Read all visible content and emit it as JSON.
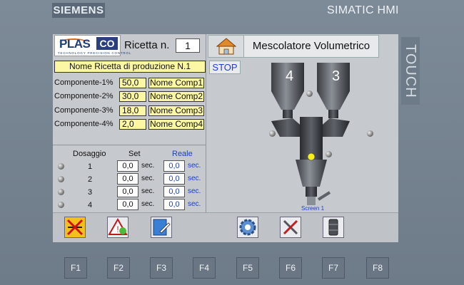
{
  "device": {
    "brand": "SIEMENS",
    "model": "SIMATIC HMI",
    "touch_label": "TOUCH"
  },
  "logo": {
    "main": "PLAS",
    "box": "CO",
    "subtitle": "TECHNOLOGY PRECISION CONTROL"
  },
  "recipe": {
    "label": "Ricetta n.",
    "number": "1",
    "name": "Nome Ricetta di produzione N.1"
  },
  "header": {
    "title": "Mescolatore Volumetrico",
    "stop_label": "STOP",
    "home_icon": "home-icon"
  },
  "components": [
    {
      "label": "Componente-1%",
      "value": "50,0",
      "name": "Nome Comp1"
    },
    {
      "label": "Componente-2%",
      "value": "30,0",
      "name": "Nome Comp2"
    },
    {
      "label": "Componente-3%",
      "value": "18,0",
      "name": "Nome Comp3"
    },
    {
      "label": "Componente-4%",
      "value": "2,0",
      "name": "Nome Comp4"
    }
  ],
  "dosing_table": {
    "headers": {
      "dosaggio": "Dosaggio",
      "set": "Set",
      "reale": "Reale"
    },
    "rows": [
      {
        "n": "1",
        "set": "0,0",
        "set_unit": "sec.",
        "real": "0,0",
        "real_unit": "sec."
      },
      {
        "n": "2",
        "set": "0,0",
        "set_unit": "sec.",
        "real": "0,0",
        "real_unit": "sec."
      },
      {
        "n": "3",
        "set": "0,0",
        "set_unit": "sec.",
        "real": "0,0",
        "real_unit": "sec."
      },
      {
        "n": "4",
        "set": "0,0",
        "set_unit": "sec.",
        "real": "0,0",
        "real_unit": "sec."
      }
    ]
  },
  "machine": {
    "hopper_left": "4",
    "hopper_right": "3",
    "screen_label": "Screen 1"
  },
  "toolbar": [
    {
      "icon": "no-mixing-icon"
    },
    {
      "icon": "alarm-warning-icon"
    },
    {
      "icon": "edit-document-icon"
    },
    {
      "icon": "settings-gear-icon"
    },
    {
      "icon": "tools-icon"
    },
    {
      "icon": "barrel-icon"
    }
  ],
  "function_keys": [
    "F1",
    "F2",
    "F3",
    "F4",
    "F5",
    "F6",
    "F7",
    "F8"
  ],
  "colors": {
    "bezel": "#6f7d8c",
    "screen": "#c6c9ce",
    "field_yellow": "#fbf7a4",
    "accent_blue": "#1d3fc4",
    "accent_orange": "#e06b17"
  }
}
